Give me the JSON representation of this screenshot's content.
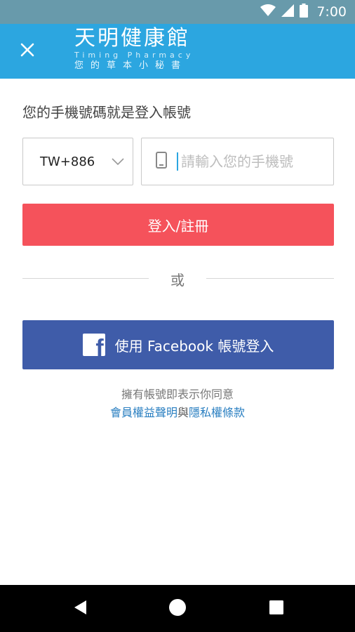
{
  "status_bar": {
    "time": "7:00",
    "icons": [
      "wifi-icon",
      "signal-icon",
      "battery-icon"
    ]
  },
  "app_bar": {
    "close_icon": "close-icon",
    "logo": {
      "title": "天明健康館",
      "english": "Timing Pharmacy",
      "subtitle": "您的草本小秘書"
    }
  },
  "login": {
    "prompt": "您的手機號碼就是登入帳號",
    "country_code": "TW+886",
    "phone_placeholder": "請輸入您的手機號",
    "phone_value": "",
    "submit_label": "登入/註冊",
    "or_label": "或",
    "facebook_label": "使用 Facebook 帳號登入"
  },
  "terms": {
    "consent": "擁有帳號即表示你同意",
    "member_link": "會員權益聲明",
    "connector": "與",
    "privacy_link": "隱私權條款"
  },
  "colors": {
    "status_bar": "#689aab",
    "app_bar": "#2ca6e0",
    "login_button": "#f5525b",
    "facebook_button": "#3f5ca9",
    "link": "#2a7fc1"
  }
}
